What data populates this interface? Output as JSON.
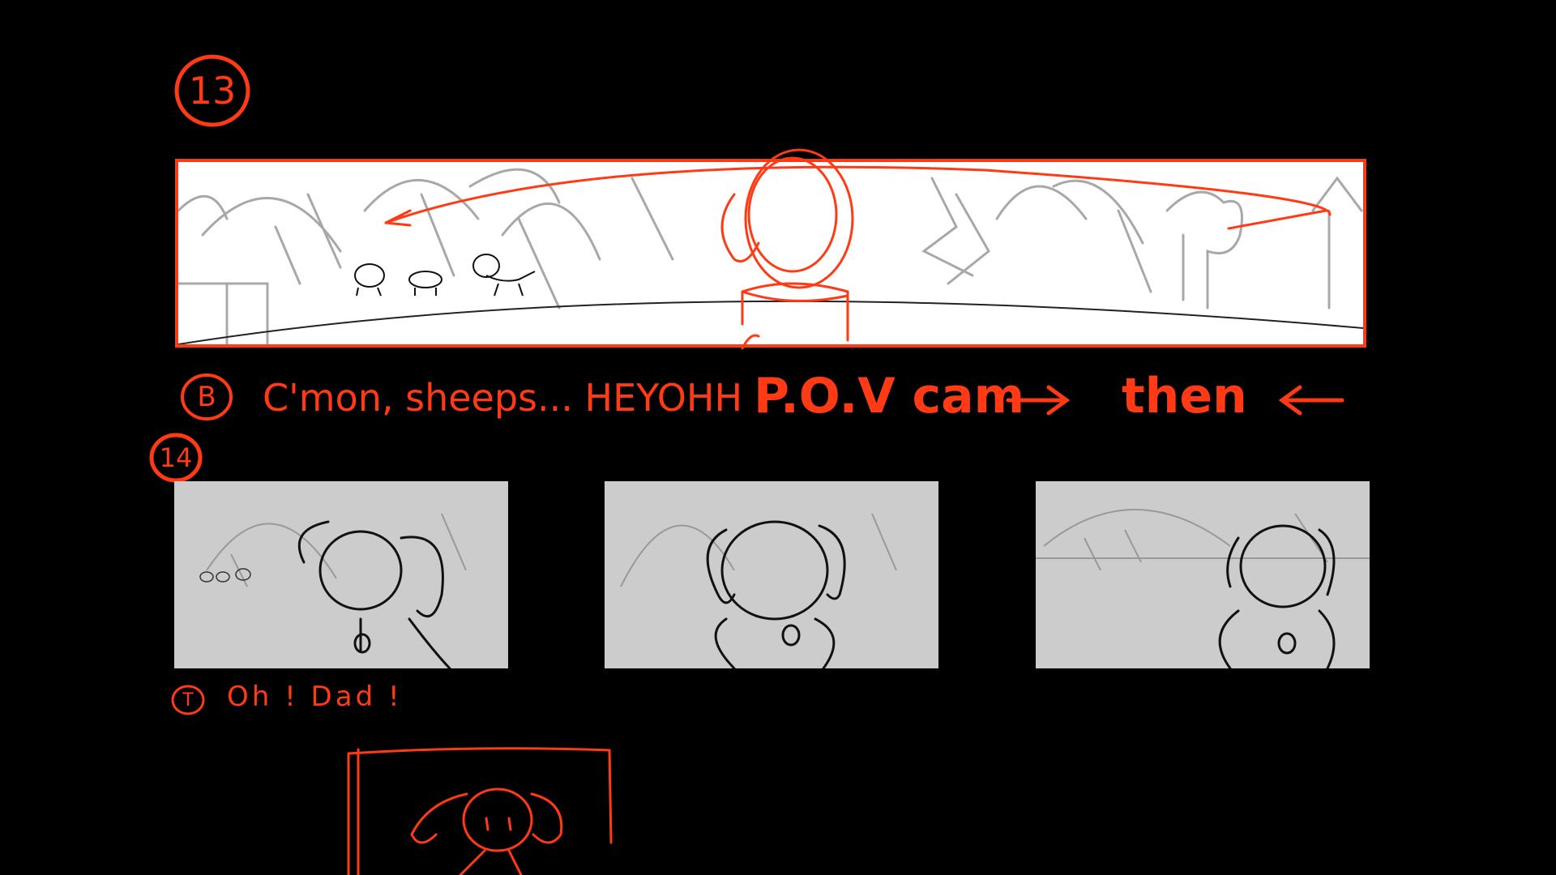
{
  "colors": {
    "background": "#000000",
    "annotation": "#ff3a14",
    "panel": "#cccccc",
    "pano": "#ffffff"
  },
  "scene13": {
    "number": "13",
    "dialogue_marker": "B",
    "dialogue": "C'mon, sheeps... HEYOHH",
    "camera_note": "P.O.V cam",
    "then_label": "then"
  },
  "scene14": {
    "number": "14",
    "dialogue_marker": "T",
    "dialogue": "Oh ! Dad !",
    "tag_letter": "T"
  }
}
